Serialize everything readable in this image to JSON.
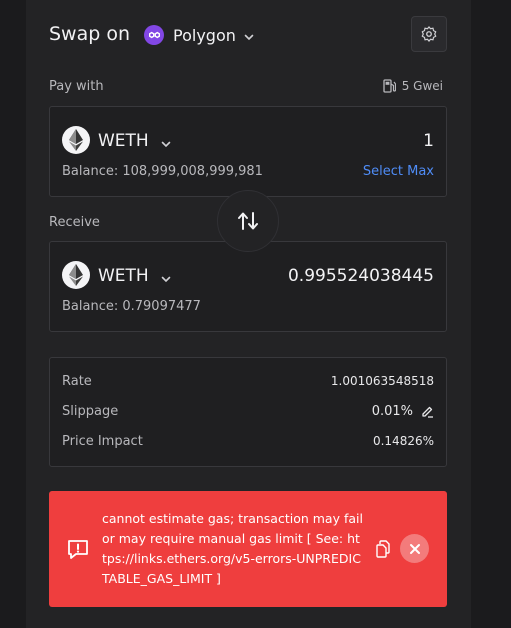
{
  "header": {
    "title": "Swap on",
    "chain": "Polygon",
    "chain_icon": "polygon-icon",
    "settings_icon": "gear-icon"
  },
  "pay": {
    "label": "Pay with",
    "gas": "5 Gwei",
    "gas_icon": "gas-pump-icon",
    "token": "WETH",
    "amount": "1",
    "balance": "Balance: 108,999,008,999,981",
    "select_max": "Select Max"
  },
  "receive": {
    "label": "Receive",
    "token": "WETH",
    "amount": "0.995524038445",
    "balance": "Balance: 0.79097477"
  },
  "info": {
    "rate_label": "Rate",
    "rate_value": "1.001063548518",
    "slippage_label": "Slippage",
    "slippage_value": "0.01%",
    "impact_label": "Price Impact",
    "impact_value": "0.14826%"
  },
  "error": {
    "message": "cannot estimate gas; transaction may fail or may require manual gas limit [ See: https://links.ethers.org/v5-errors-UNPREDICTABLE_GAS_LIMIT ]",
    "background_color": "#ef3e3e"
  },
  "colors": {
    "accent": "#4f8cf6",
    "polygon": "#8247e5"
  }
}
